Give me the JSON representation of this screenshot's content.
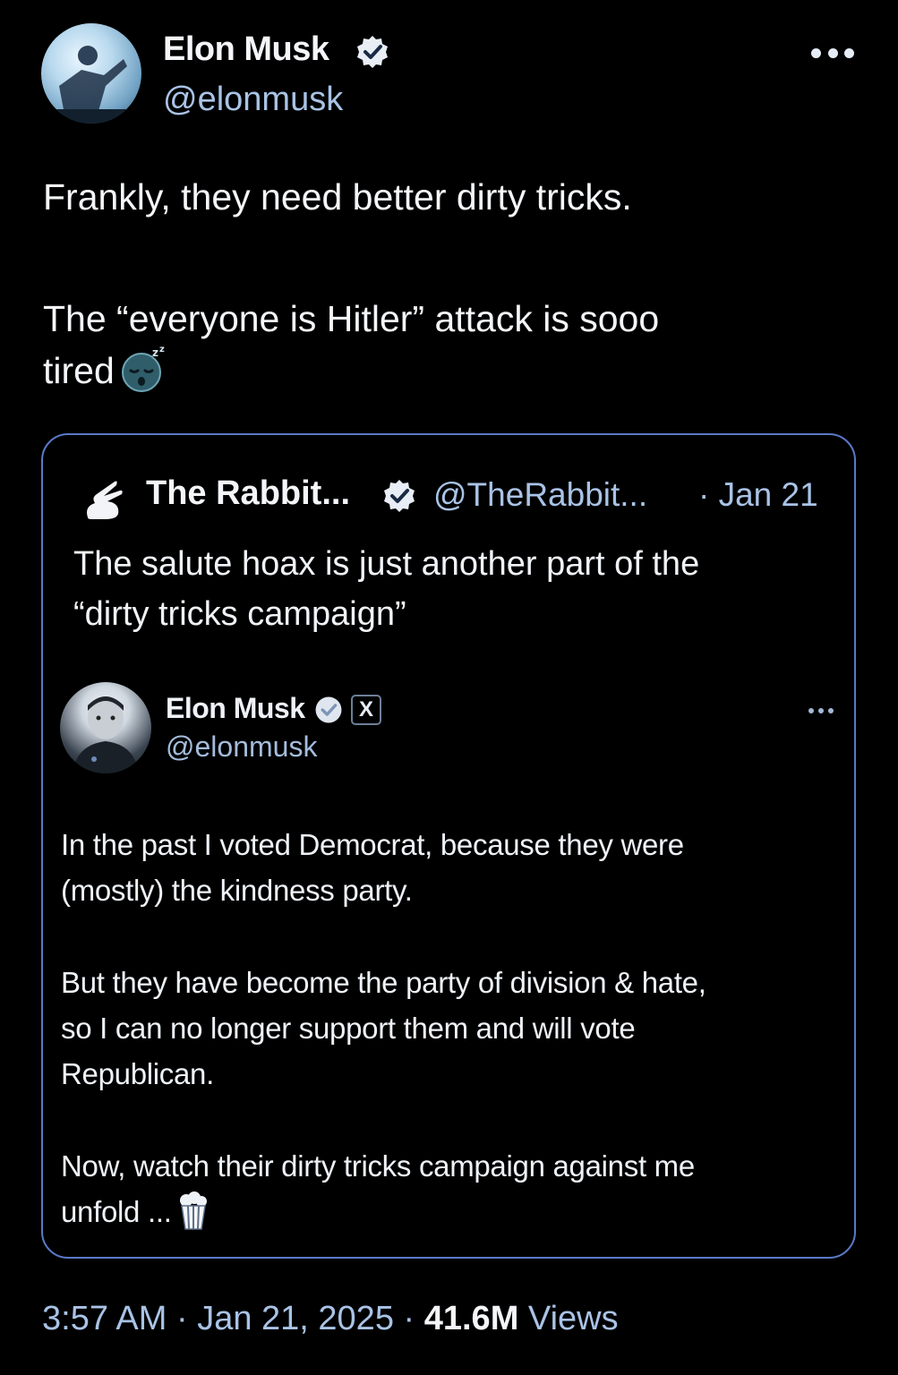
{
  "author": {
    "name": "Elon Musk",
    "handle": "@elonmusk"
  },
  "tweet": {
    "line1": "Frankly, they need better dirty tricks.",
    "line2": "The “everyone is Hitler” attack is sooo",
    "line3": "tired",
    "emoji": "sleeping-face-icon"
  },
  "quote": {
    "name": "The Rabbit...",
    "handle": "@TheRabbit...",
    "date": "· Jan 21",
    "text_line1": "The salute hoax is just another part of the",
    "text_line2": "“dirty tricks campaign”",
    "embedded": {
      "name": "Elon Musk",
      "badge": "X",
      "handle": "@elonmusk",
      "p1_l1": "In the past I voted Democrat, because they were",
      "p1_l2": "(mostly) the kindness party.",
      "p2_l1": "But they have become the party of division & hate,",
      "p2_l2": "so I can no longer support them and will vote",
      "p2_l3": "Republican.",
      "p3_l1": "Now, watch their dirty tricks campaign against me",
      "p3_l2": "unfold ..."
    }
  },
  "meta": {
    "time": "3:57 AM",
    "sep1": " · ",
    "date": "Jan 21, 2025",
    "sep2": " · ",
    "views_count": "41.6M",
    "views_label": " Views"
  },
  "colors": {
    "background": "#000000",
    "verified": "#e9eef6",
    "link_muted": "#a9c3e6",
    "card_border": "#5a79c8"
  }
}
